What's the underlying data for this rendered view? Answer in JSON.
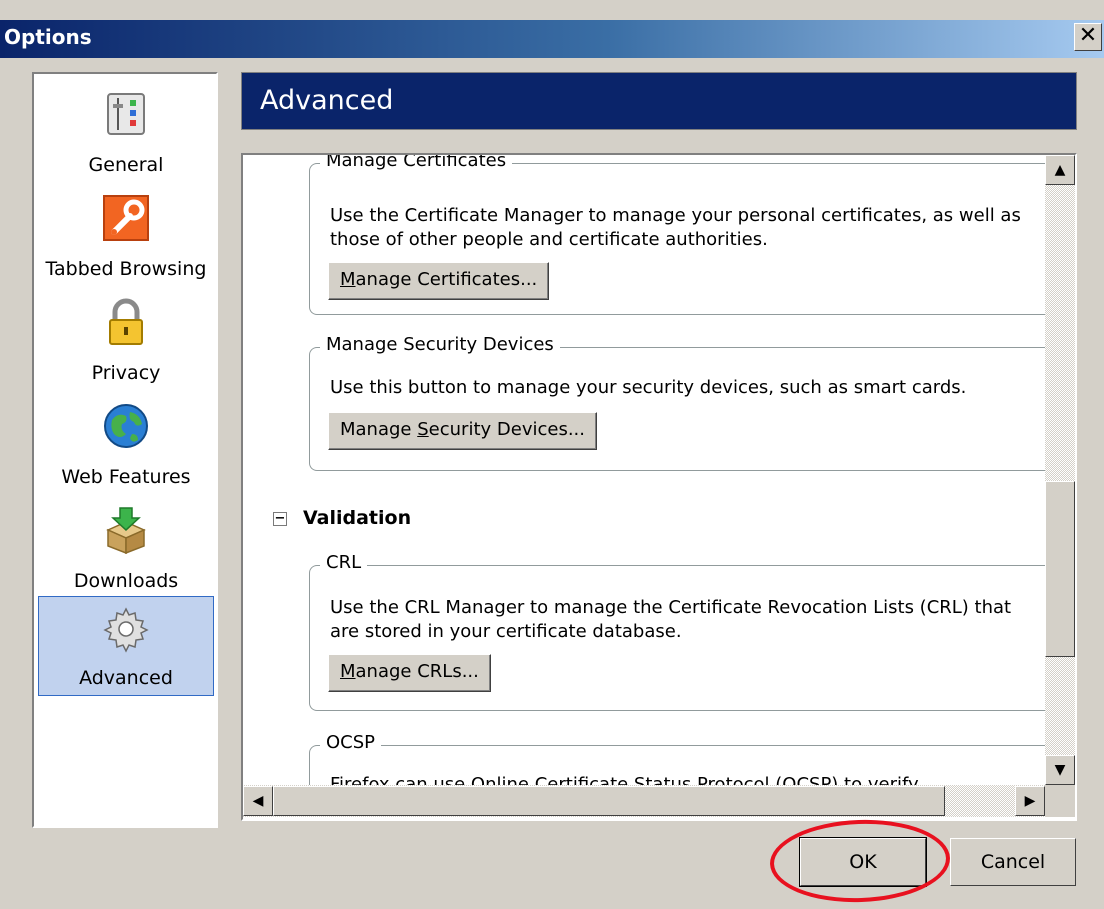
{
  "window": {
    "title": "Options",
    "close_glyph": "✕"
  },
  "sidebar": {
    "items": [
      {
        "label": "General",
        "icon": "general-icon"
      },
      {
        "label": "Tabbed Browsing",
        "icon": "tabbed-browsing-icon"
      },
      {
        "label": "Privacy",
        "icon": "padlock-icon"
      },
      {
        "label": "Web Features",
        "icon": "globe-icon"
      },
      {
        "label": "Downloads",
        "icon": "downloads-box-icon"
      },
      {
        "label": "Advanced",
        "icon": "gear-icon",
        "selected": true
      }
    ]
  },
  "header": {
    "title": "Advanced"
  },
  "sections": {
    "certificates": {
      "legend": "Manage Certificates",
      "desc1": "Use the Certificate Manager to manage your personal certificates, as well as",
      "desc2": "those of other people and certificate authorities.",
      "button_pre": "",
      "button_u": "M",
      "button_post": "anage Certificates..."
    },
    "devices": {
      "legend": "Manage Security Devices",
      "desc": "Use this button to manage your security devices, such as smart cards.",
      "button_pre": "Manage ",
      "button_u": "S",
      "button_post": "ecurity Devices..."
    },
    "validation": {
      "title": "Validation",
      "toggle": "−"
    },
    "crl": {
      "legend": "CRL",
      "desc1": "Use the CRL Manager to manage the Certificate Revocation Lists (CRL) that",
      "desc2": "are stored in your certificate database.",
      "button_pre": "",
      "button_u": "M",
      "button_post": "anage CRLs..."
    },
    "ocsp": {
      "legend": "OCSP",
      "desc_partial": "Firefox can use Online Certificate Status Protocol (OCSP) to verify"
    }
  },
  "scrollbars": {
    "up": "▲",
    "down": "▼",
    "left": "◀",
    "right": "▶"
  },
  "footer": {
    "ok_label": "OK",
    "cancel_label": "Cancel"
  },
  "annotation": {
    "color": "#e8111f"
  }
}
